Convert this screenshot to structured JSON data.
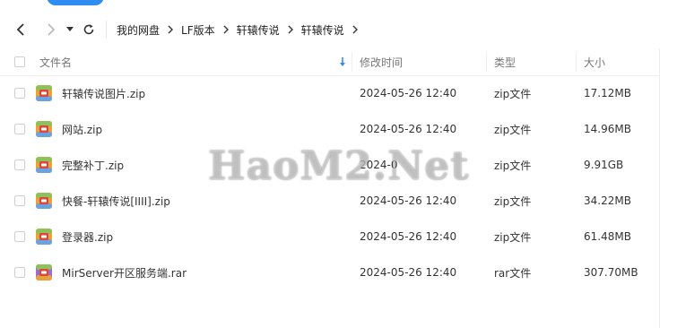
{
  "nav": {
    "back_icon": "chevron-left-icon",
    "forward_icon": "chevron-right-icon",
    "history_icon": "caret-down-icon",
    "refresh_icon": "refresh-icon",
    "breadcrumbs": [
      "我的网盘",
      "LF版本",
      "轩辕传说",
      "轩辕传说"
    ]
  },
  "header": {
    "name": "文件名",
    "modified": "修改时间",
    "type": "类型",
    "size": "大小"
  },
  "files": [
    {
      "name": "轩辕传说图片.zip",
      "modified": "2024-05-26 12:40",
      "type": "zip文件",
      "size": "17.12MB",
      "icon": "zip-archive-icon"
    },
    {
      "name": "网站.zip",
      "modified": "2024-05-26 12:40",
      "type": "zip文件",
      "size": "14.96MB",
      "icon": "zip-archive-icon"
    },
    {
      "name": "完整补丁.zip",
      "modified": "2024-0",
      "type": "zip文件",
      "size": "9.91GB",
      "icon": "zip-archive-icon"
    },
    {
      "name": "快餐-轩辕传说[IIII].zip",
      "modified": "2024-05-26 12:40",
      "type": "zip文件",
      "size": "34.22MB",
      "icon": "zip-archive-icon"
    },
    {
      "name": "登录器.zip",
      "modified": "2024-05-26 12:40",
      "type": "zip文件",
      "size": "61.48MB",
      "icon": "zip-archive-icon"
    },
    {
      "name": "MirServer开区服务端.rar",
      "modified": "2024-05-26 12:40",
      "type": "rar文件",
      "size": "307.70MB",
      "icon": "rar-archive-icon"
    }
  ],
  "watermark": "HaoM2.Net",
  "colors": {
    "accent": "#2f8cf0",
    "sort_arrow": "#2f8cf0"
  }
}
